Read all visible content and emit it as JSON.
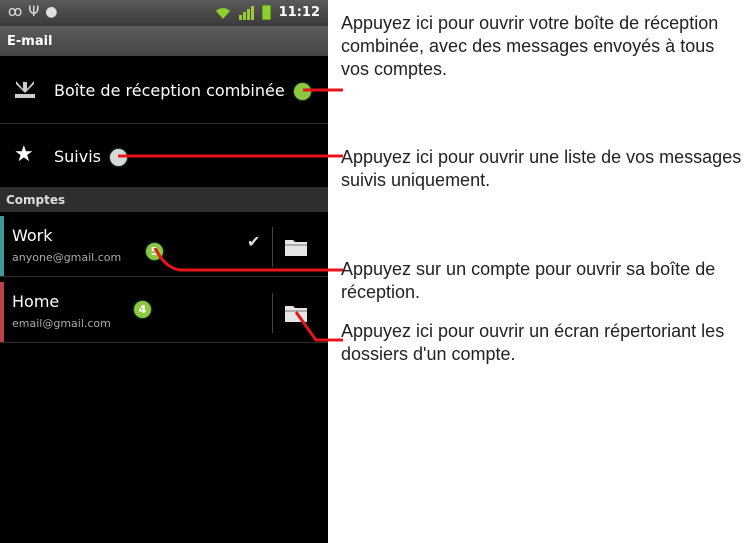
{
  "status_bar": {
    "time": "11:12"
  },
  "title_bar": {
    "title": "E-mail"
  },
  "combined_inbox": {
    "label": "Boîte de réception combinée"
  },
  "starred": {
    "label": "Suivis"
  },
  "section": {
    "title": "Comptes"
  },
  "accounts": [
    {
      "name": "Work",
      "email": "anyone@gmail.com",
      "badge": "5",
      "stripe_color": "#3d9a9a",
      "checked": true
    },
    {
      "name": "Home",
      "email": "email@gmail.com",
      "badge": "4",
      "stripe_color": "#c0404a",
      "checked": false
    }
  ],
  "callouts": [
    "Appuyez ici pour ouvrir votre boîte de réception combinée, avec des messages envoyés à tous vos comptes.",
    "Appuyez ici pour ouvrir une liste de vos messages suivis uniquement.",
    "Appuyez sur un compte pour ouvrir sa boîte de réception.",
    "Appuyez ici pour ouvrir un écran répertoriant les dossiers d'un compte."
  ],
  "colors": {
    "callout_line": "#e8141b",
    "badge": "#8dc63f",
    "background": "#000000"
  }
}
